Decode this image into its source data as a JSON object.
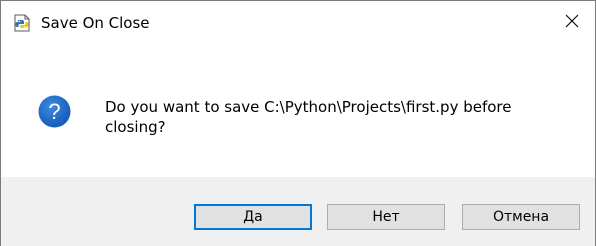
{
  "window": {
    "title": "Save On Close",
    "app_icon": "python-idle-icon",
    "close_icon": "close-icon"
  },
  "content": {
    "icon": "question-icon",
    "message": "Do you want to save C:\\Python\\Projects\\first.py before closing?"
  },
  "buttons": {
    "yes_label": "Да",
    "no_label": "Нет",
    "cancel_label": "Отмена",
    "default": "yes"
  },
  "colors": {
    "question_icon_blue": "#1a6fcf",
    "focus_border": "#0078d7",
    "footer_background": "#f0f0f0",
    "button_face": "#e1e1e1"
  }
}
